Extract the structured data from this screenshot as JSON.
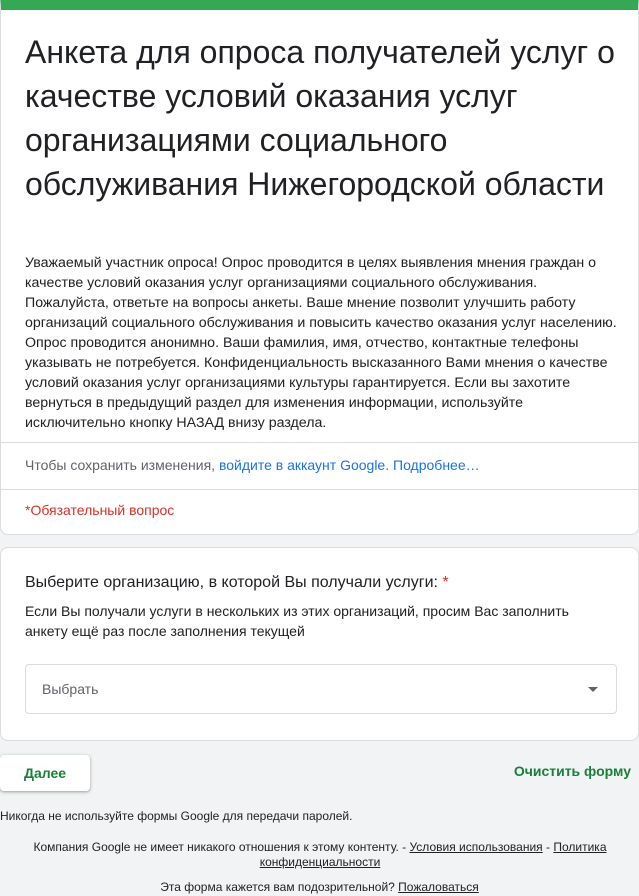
{
  "header": {
    "title": "Анкета для опроса получателей услуг о качестве условий оказания услуг организациями социального обслуживания Нижегородской области",
    "description": "Уважаемый участник опроса! Опрос проводится в целях выявления мнения граждан о качестве условий оказания услуг организациями социального обслуживания. Пожалуйста, ответьте на вопросы анкеты. Ваше мнение позволит улучшить работу организаций социального обслуживания и повысить качество оказания услуг населению. Опрос проводится анонимно. Ваши фамилия, имя, отчество, контактные телефоны указывать не потребуется. Конфиденциальность высказанного Вами мнения о качестве условий оказания услуг организациями культуры гарантируется. Если вы захотите вернуться в предыдущий раздел для изменения информации, используйте исключительно кнопку НАЗАД внизу раздела.",
    "signin_prefix": "Чтобы сохранить изменения, ",
    "signin_link": "войдите в аккаунт Google.",
    "more_link": "Подробнее…",
    "required_note": "*Обязательный вопрос"
  },
  "question": {
    "title": "Выберите организацию, в которой Вы получали услуги:",
    "required_mark": "*",
    "description": "Если Вы получали услуги в нескольких из этих организаций, просим Вас заполнить анкету ещё раз после заполнения текущей",
    "select_placeholder": "Выбрать"
  },
  "actions": {
    "next_label": "Далее",
    "clear_label": "Очистить форму"
  },
  "footer": {
    "password_note": "Никогда не используйте формы Google для передачи паролей.",
    "disclaimer_prefix": "Компания Google не имеет никакого отношения к этому контенту. - ",
    "terms_link": "Условия использования",
    "separator": " - ",
    "privacy_link": "Политика конфиденциальности",
    "suspicious_prefix": "Эта форма кажется вам подозрительной? ",
    "report_link": "Пожаловаться"
  },
  "colors": {
    "accent": "#34a853",
    "button_text": "#188038",
    "required": "#d93025",
    "link": "#1a73e8"
  }
}
